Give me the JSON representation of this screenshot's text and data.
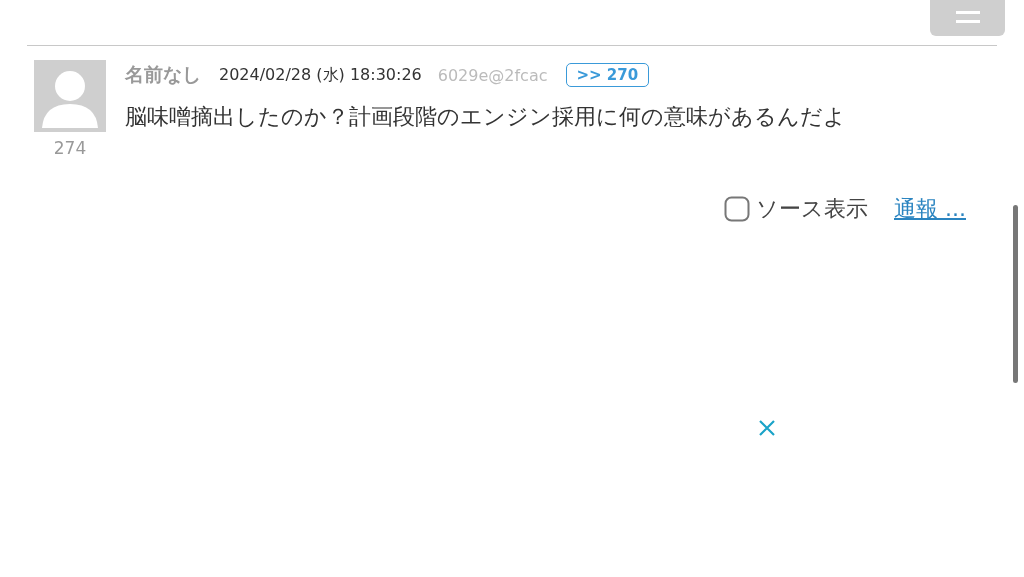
{
  "post": {
    "name": "名前なし",
    "date": "2024/02/28 (水) 18:30:26",
    "user_id": "6029e@2fcac",
    "reply_ref": ">> 270",
    "number": "274",
    "body": "脳味噌摘出したのか？計画段階のエンジン採用に何の意味があるんだよ"
  },
  "source_toggle": {
    "label": "ソース表示",
    "checked": false
  },
  "report_link": "通報 ..."
}
